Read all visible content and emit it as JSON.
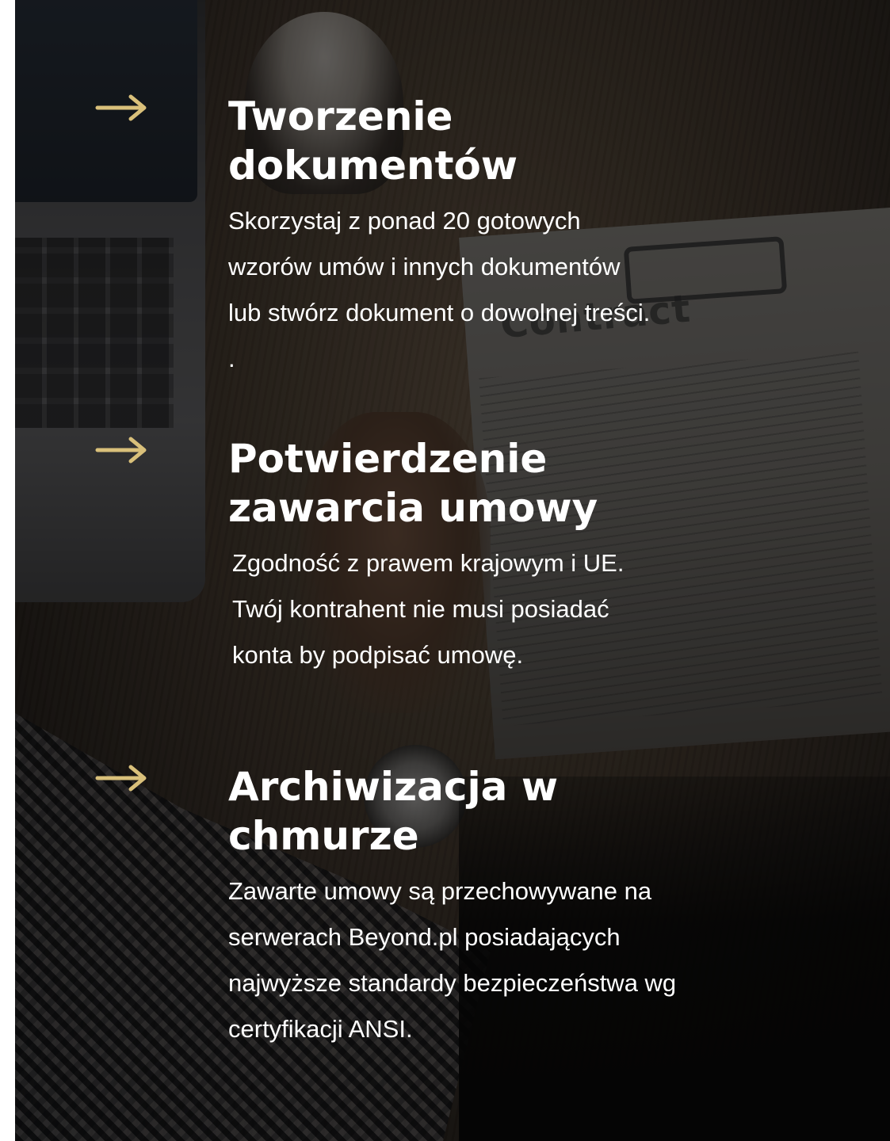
{
  "colors": {
    "accent": "#d9c07a",
    "text": "#ffffff",
    "overlay": "rgba(0,0,0,0.52)"
  },
  "features": [
    {
      "icon": "arrow-right-icon",
      "title": "Tworzenie dokumentów",
      "text": "Skorzystaj z ponad 20 gotowych wzorów umów i innych dokumentów lub stwórz dokument o dowolnej treści. ."
    },
    {
      "icon": "arrow-right-icon",
      "title": "Potwierdzenie zawarcia umowy",
      "text": "Zgodność z prawem krajowym i UE. Twój kontrahent nie musi posiadać konta by podpisać umowę."
    },
    {
      "icon": "arrow-right-icon",
      "title": "Archiwizacja w chmurze",
      "text": "Zawarte umowy są przechowywane na serwerach Beyond.pl posiadających najwyższe standardy bezpieczeństwa wg certyfikacji ANSI."
    }
  ]
}
